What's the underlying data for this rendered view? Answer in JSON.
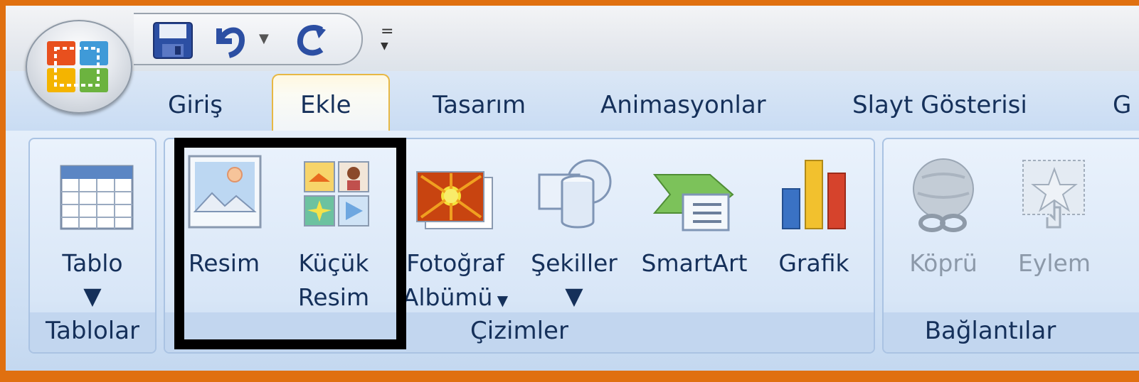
{
  "tabs": [
    "Giriş",
    "Ekle",
    "Tasarım",
    "Animasyonlar",
    "Slayt Gösterisi",
    "G"
  ],
  "active_tab": "Ekle",
  "groups": {
    "tablolar": {
      "label": "Tablolar",
      "tablo": "Tablo"
    },
    "cizimler": {
      "label": "Çizimler",
      "resim": "Resim",
      "kucuk_resim_1": "Küçük",
      "kucuk_resim_2": "Resim",
      "fotograf_1": "Fotoğraf",
      "fotograf_2": "Albümü",
      "sekiller": "Şekiller",
      "smartart": "SmartArt",
      "grafik": "Grafik"
    },
    "baglantilar": {
      "label": "Bağlantılar",
      "kopru": "Köprü",
      "eylem": "Eylem"
    }
  },
  "colors": {
    "frame": "#e07010",
    "tab_text": "#15305a",
    "highlight": "#000000"
  },
  "icons": [
    "office-logo-icon",
    "save-icon",
    "undo-icon",
    "redo-icon",
    "customize-qat-icon",
    "table-icon",
    "picture-icon",
    "clipart-icon",
    "photo-album-icon",
    "shapes-icon",
    "smartart-icon",
    "chart-icon",
    "hyperlink-icon",
    "action-icon"
  ]
}
